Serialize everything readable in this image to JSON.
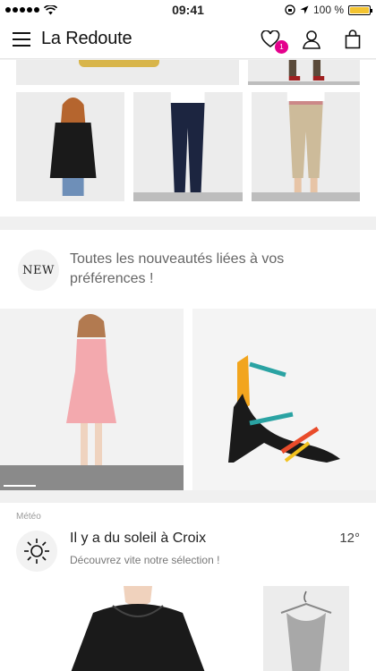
{
  "status_bar": {
    "time": "09:41",
    "battery": "100 %",
    "battery_level": 1.0
  },
  "header": {
    "brand": "La Redoute",
    "wishlist_badge": "1"
  },
  "new_section": {
    "badge": "NEW",
    "text": "Toutes les nouveautés liées à vos préférences !"
  },
  "meteo": {
    "label": "Météo",
    "title": "Il y a du soleil à Croix",
    "subtitle": "Découvrez vite notre sélection !",
    "temperature": "12°"
  },
  "icons": {
    "menu": "hamburger-icon",
    "wishlist": "heart-icon",
    "account": "user-icon",
    "cart": "bag-icon",
    "weather": "sun-icon"
  },
  "colors": {
    "badge": "#e4008c",
    "battery": "#f4c430"
  }
}
